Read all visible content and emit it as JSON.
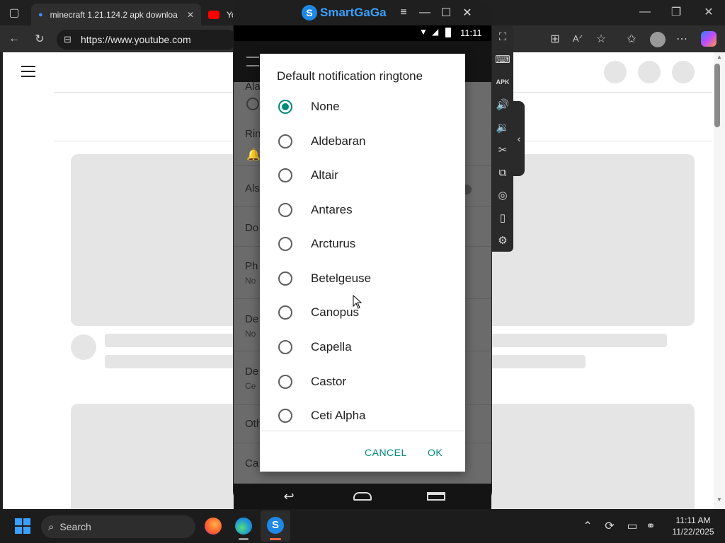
{
  "browser": {
    "tabs": [
      {
        "title": "minecraft 1.21.124.2 apk downloa"
      },
      {
        "title": "You"
      }
    ],
    "url": "https://www.youtube.com"
  },
  "emulator": {
    "brand": "SmartGaGa",
    "time": "11:11"
  },
  "app_background": {
    "rows": [
      "Ala",
      "Rin",
      "Als",
      "Do",
      "Ph",
      "No",
      "De",
      "No",
      "De",
      "Ce",
      "Oth",
      "Ca"
    ]
  },
  "dialog": {
    "title": "Default notification ringtone",
    "options": [
      {
        "label": "None",
        "selected": true
      },
      {
        "label": "Aldebaran",
        "selected": false
      },
      {
        "label": "Altair",
        "selected": false
      },
      {
        "label": "Antares",
        "selected": false
      },
      {
        "label": "Arcturus",
        "selected": false
      },
      {
        "label": "Betelgeuse",
        "selected": false
      },
      {
        "label": "Canopus",
        "selected": false
      },
      {
        "label": "Capella",
        "selected": false
      },
      {
        "label": "Castor",
        "selected": false
      },
      {
        "label": "Ceti Alpha",
        "selected": false
      }
    ],
    "cancel": "CANCEL",
    "ok": "OK"
  },
  "taskbar": {
    "search_label": "Search",
    "time": "11:11 AM",
    "date": "11/22/2025"
  },
  "colors": {
    "accent": "#00897b"
  }
}
